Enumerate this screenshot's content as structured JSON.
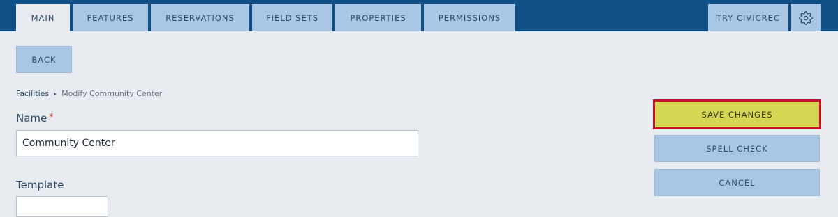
{
  "tabs": [
    {
      "label": "Main",
      "active": true
    },
    {
      "label": "Features"
    },
    {
      "label": "Reservations"
    },
    {
      "label": "Field Sets"
    },
    {
      "label": "Properties"
    },
    {
      "label": "Permissions"
    }
  ],
  "header_right": {
    "try_label": "Try CivicRec",
    "settings_icon": "gear-icon"
  },
  "back_label": "Back",
  "breadcrumb": {
    "root": "Facilities",
    "separator": "▸",
    "current": "Modify Community Center"
  },
  "form": {
    "name_label": "Name",
    "required_marker": "*",
    "name_value": "Community Center",
    "template_label": "Template"
  },
  "actions": {
    "save_label": "Save Changes",
    "spell_label": "Spell Check",
    "cancel_label": "Cancel"
  },
  "colors": {
    "topbar": "#0f4f85",
    "tab": "#aac6e5",
    "page_bg": "#e8ebf0",
    "save_bg": "#d4d654",
    "save_highlight_border": "#c8102e"
  }
}
